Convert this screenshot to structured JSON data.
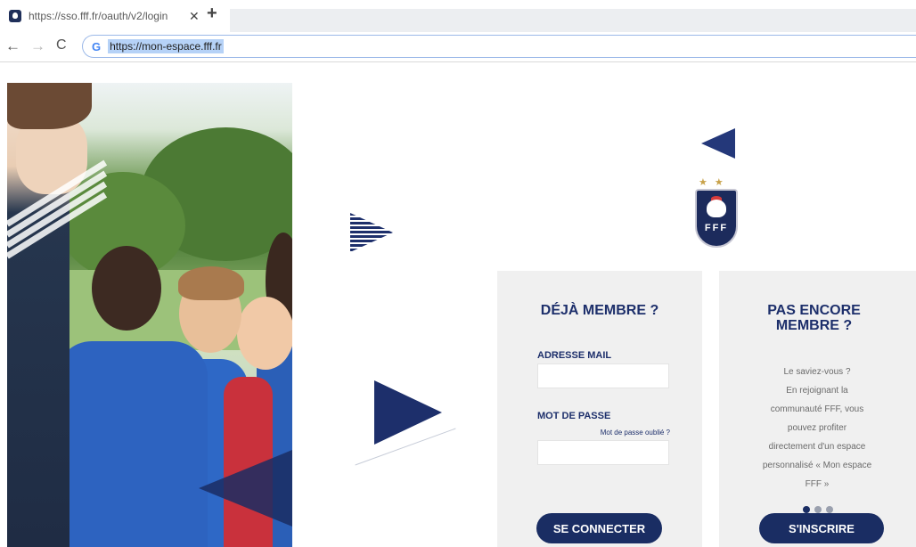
{
  "browser": {
    "tab_title": "https://sso.fff.fr/oauth/v2/login",
    "tab_close": "✕",
    "new_tab": "+",
    "nav_back": "←",
    "nav_forward": "→",
    "nav_reload": "C",
    "omnibox_icon": "G",
    "url": "https://mon-espace.fff.fr"
  },
  "logo": {
    "stars": "★★",
    "text": "FFF"
  },
  "login_panel": {
    "title": "DÉJÀ MEMBRE ?",
    "email_label": "ADRESSE MAIL",
    "email_value": "",
    "password_label": "MOT DE PASSE",
    "forgot_password": "Mot de passe oublié ?",
    "password_value": "",
    "submit_label": "SE CONNECTER"
  },
  "register_panel": {
    "title_line1": "PAS ENCORE",
    "title_line2": "MEMBRE ?",
    "text_lines": [
      "Le saviez-vous ?",
      "En rejoignant la",
      "communauté FFF, vous",
      "pouvez profiter",
      "directement d'un espace",
      "personnalisé « Mon espace",
      "FFF »"
    ],
    "submit_label": "S'INSCRIRE",
    "carousel_active_index": 0,
    "carousel_count": 3
  },
  "colors": {
    "brand_navy": "#1a2d63",
    "panel_bg": "#f0f0f0",
    "gold": "#c8a24a"
  },
  "icons": {
    "favicon": "fff-shield-icon",
    "back": "arrow-left-icon",
    "forward": "arrow-right-icon",
    "reload": "reload-icon",
    "google": "google-g-icon"
  }
}
